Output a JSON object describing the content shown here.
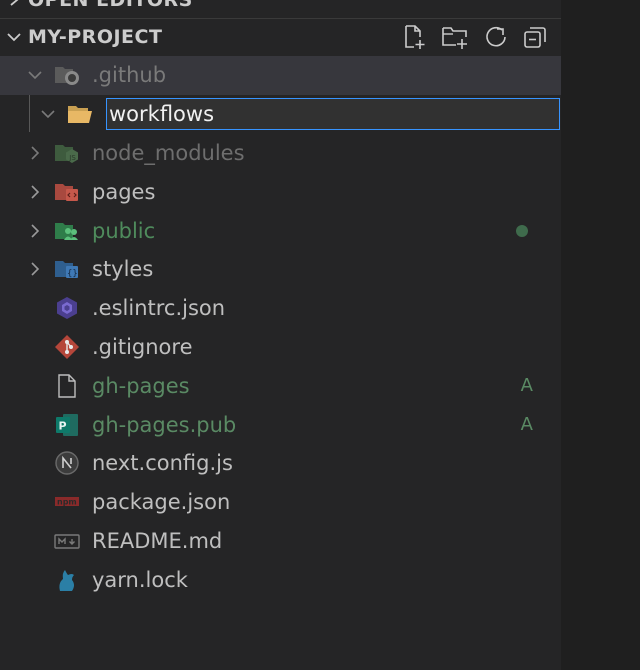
{
  "sections": {
    "open_editors": {
      "label": "OPEN EDITORS"
    },
    "project": {
      "label": "MY-PROJECT",
      "actions": [
        {
          "name": "new-file",
          "icon": "new-file-icon"
        },
        {
          "name": "new-folder",
          "icon": "new-folder-icon"
        },
        {
          "name": "refresh",
          "icon": "refresh-icon"
        },
        {
          "name": "collapse-all",
          "icon": "collapse-all-icon"
        }
      ]
    }
  },
  "tree": {
    "github": {
      "label": ".github",
      "icon": "github-folder-icon",
      "expanded": true
    },
    "workflows": {
      "value": "workflows",
      "icon": "folder-open-icon"
    },
    "node_modules": {
      "label": "node_modules",
      "icon": "node-folder-icon"
    },
    "pages": {
      "label": "pages",
      "icon": "pages-folder-icon"
    },
    "public": {
      "label": "public",
      "icon": "public-folder-icon",
      "status": "modified"
    },
    "styles": {
      "label": "styles",
      "icon": "styles-folder-icon"
    },
    "eslintrc": {
      "label": ".eslintrc.json",
      "icon": "eslint-icon"
    },
    "gitignore": {
      "label": ".gitignore",
      "icon": "git-icon"
    },
    "gh_pages": {
      "label": "gh-pages",
      "icon": "file-icon",
      "badge": "A"
    },
    "gh_pages_pub": {
      "label": "gh-pages.pub",
      "icon": "publisher-icon",
      "badge": "A"
    },
    "next_config": {
      "label": "next.config.js",
      "icon": "nextjs-icon"
    },
    "package_json": {
      "label": "package.json",
      "icon": "npm-icon"
    },
    "readme": {
      "label": "README.md",
      "icon": "markdown-icon"
    },
    "yarn_lock": {
      "label": "yarn.lock",
      "icon": "yarn-icon"
    }
  },
  "colors": {
    "sidebar_bg": "#252526",
    "selected_row": "#37373d",
    "focus_border": "#3794ff",
    "added_git": "#5a8a64",
    "ignored_text": "#6e6e6e"
  }
}
